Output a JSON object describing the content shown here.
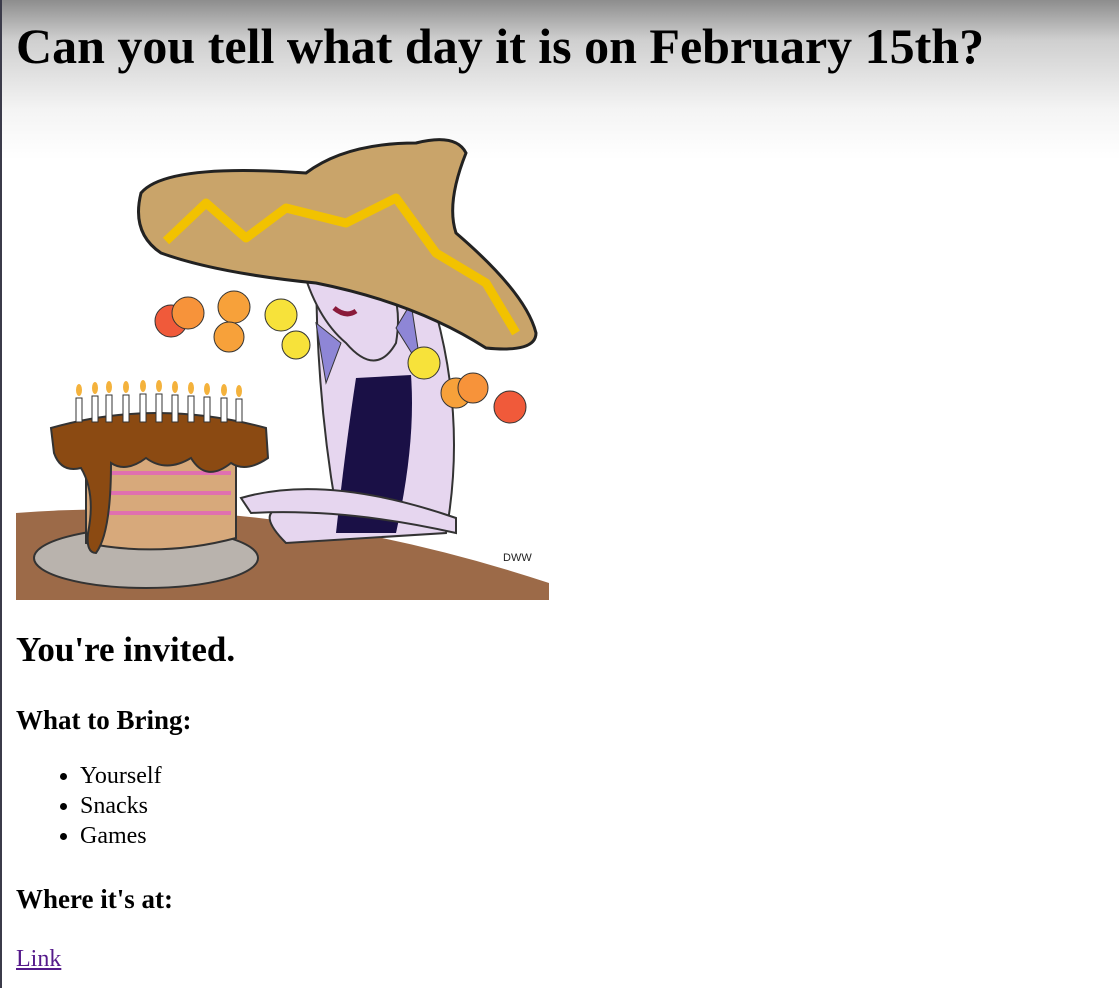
{
  "page": {
    "title": "Can you tell what day it is on February 15th?",
    "invite_heading": "You're invited.",
    "bring_heading": "What to Bring:",
    "bring_items": [
      "Yourself",
      "Snacks",
      "Games"
    ],
    "where_heading": "Where it's at:",
    "link_label": "Link"
  },
  "illustration": {
    "subject": "cartoon-woman-with-sombrero-and-birthday-cake",
    "signature": "DWW"
  },
  "colors": {
    "link_visited": "#551a8b",
    "hat": "#c9a46a",
    "hat_stripe": "#f2c200",
    "cake_chocolate": "#8b4a12",
    "cake_sponge": "#d7a97b",
    "table": "#9c6a48",
    "skin": "#e6d6ef"
  }
}
